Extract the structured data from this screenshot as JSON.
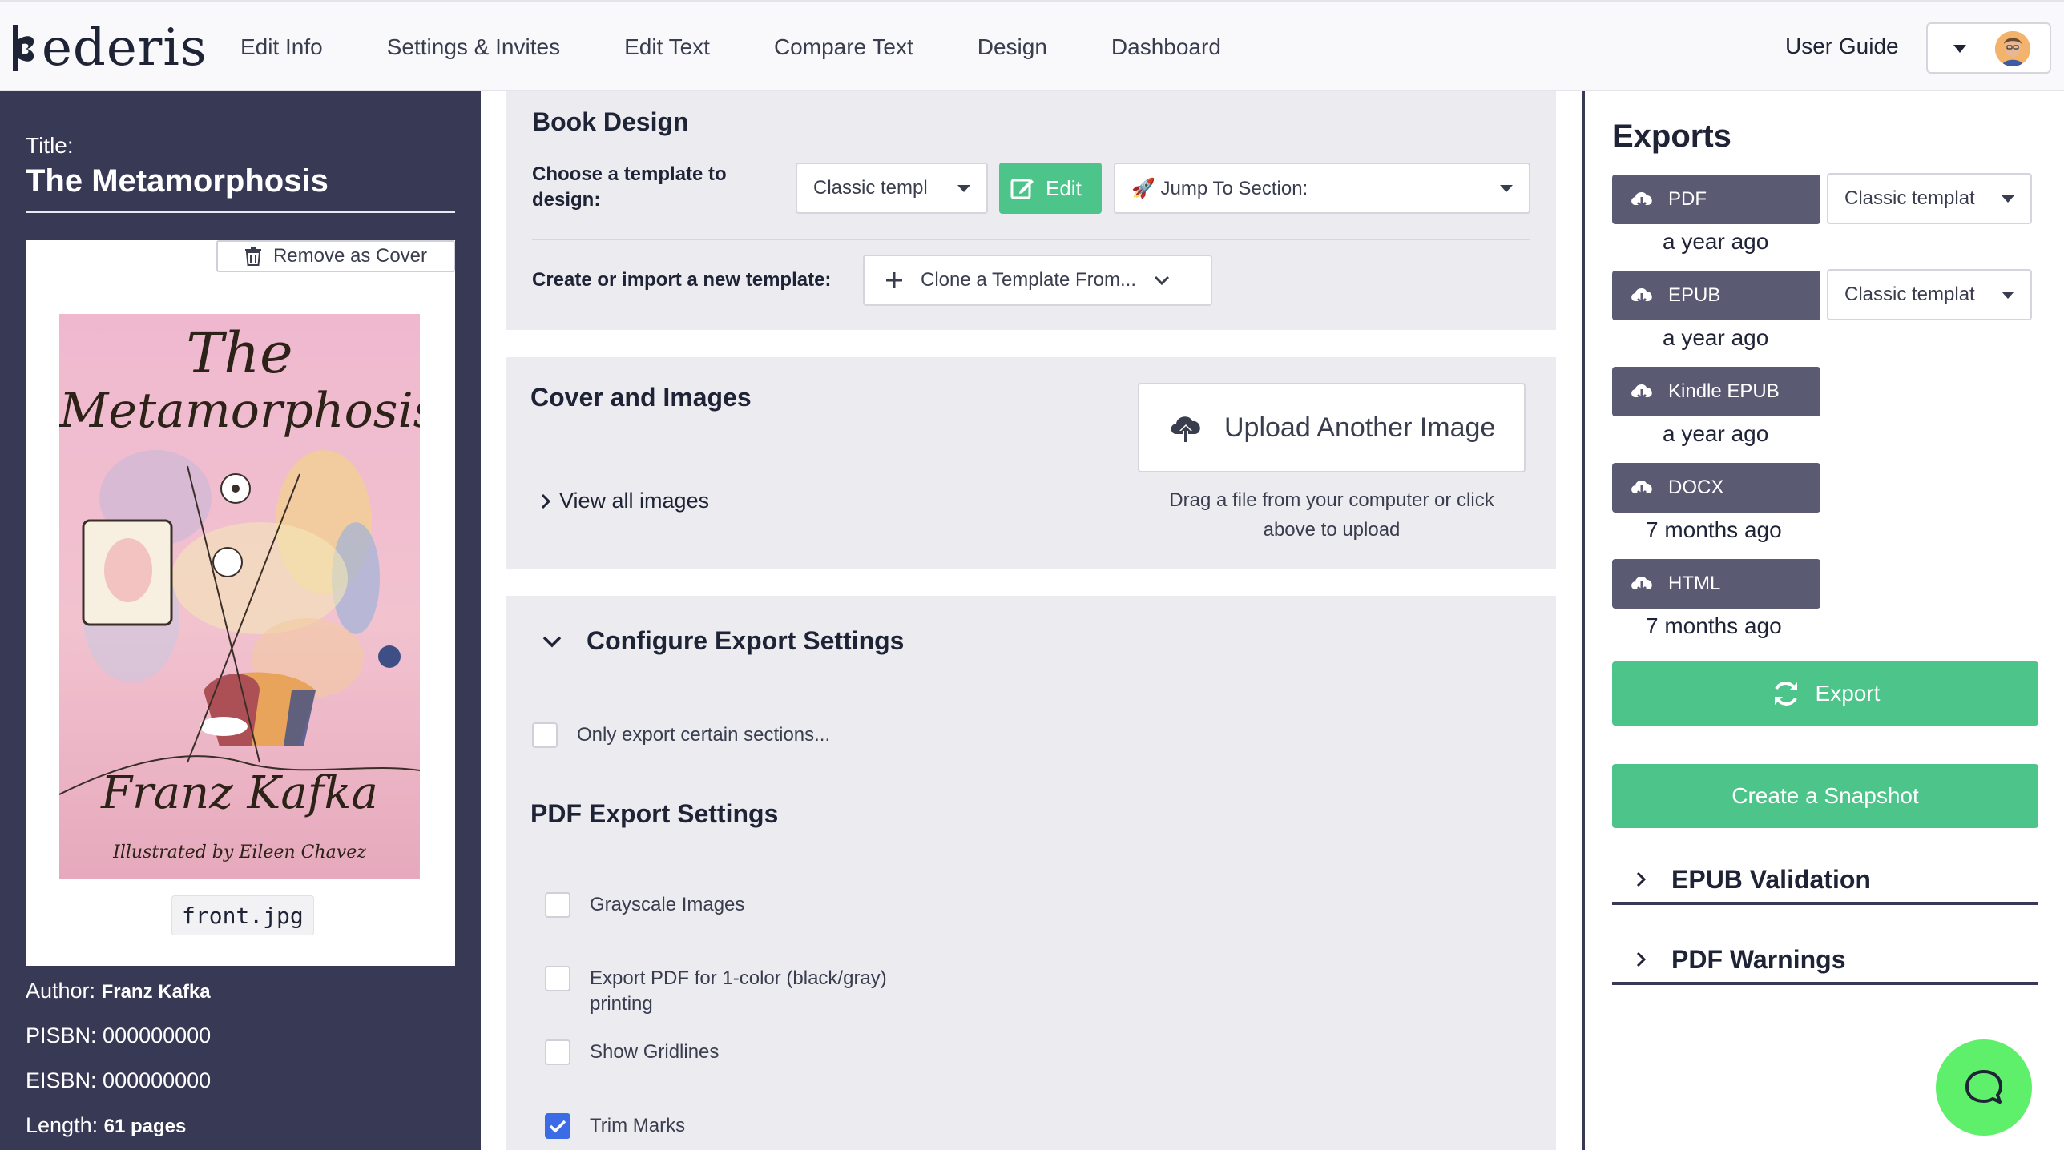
{
  "brand": {
    "name": "ederis"
  },
  "nav": {
    "items": [
      "Edit Info",
      "Settings & Invites",
      "Edit Text",
      "Compare Text",
      "Design",
      "Dashboard"
    ],
    "user_guide": "User Guide"
  },
  "sidebar": {
    "title_label": "Title:",
    "title": "The Metamorphosis",
    "remove_cover": "Remove as Cover",
    "cover": {
      "title_line1": "The",
      "title_line2": "Metamorphosis",
      "author": "Franz Kafka",
      "illustrator": "Illustrated by Eileen Chavez"
    },
    "filename": "front.jpg",
    "author_label": "Author:",
    "author": "Franz Kafka",
    "pisbn_label": "PISBN:",
    "pisbn": "000000000",
    "eisbn_label": "EISBN:",
    "eisbn": "000000000",
    "length_label": "Length:",
    "length": "61 pages"
  },
  "book_design": {
    "heading": "Book Design",
    "choose_label": "Choose a template to design:",
    "template_value": "Classic templ",
    "edit_label": "Edit",
    "jump_label": "🚀 Jump To Section:",
    "create_label": "Create or import a new template:",
    "clone_label": "Clone a Template From..."
  },
  "cover_images": {
    "heading": "Cover and Images",
    "view_all": "View all images",
    "upload_label": "Upload Another Image",
    "upload_hint": "Drag a file from your computer or click above to upload"
  },
  "export_settings": {
    "heading": "Configure Export Settings",
    "only_sections": "Only export certain sections...",
    "pdf_heading": "PDF Export Settings",
    "options": [
      {
        "label": "Grayscale Images",
        "checked": false
      },
      {
        "label": "Export PDF for 1-color (black/gray) printing",
        "checked": false
      },
      {
        "label": "Show Gridlines",
        "checked": false
      },
      {
        "label": "Trim Marks",
        "checked": true
      }
    ]
  },
  "exports": {
    "heading": "Exports",
    "items": [
      {
        "label": "PDF",
        "time": "a year ago",
        "template": "Classic templat"
      },
      {
        "label": "EPUB",
        "time": "a year ago",
        "template": "Classic templat"
      },
      {
        "label": "Kindle EPUB",
        "time": "a year ago"
      },
      {
        "label": "DOCX",
        "time": "7 months ago"
      },
      {
        "label": "HTML",
        "time": "7 months ago"
      }
    ],
    "export_button": "Export",
    "snapshot_button": "Create a Snapshot",
    "sections": [
      "EPUB Validation",
      "PDF Warnings"
    ]
  },
  "colors": {
    "sidebar_bg": "#373955",
    "accent_green": "#4cc48a",
    "export_button_bg": "#5a5b73",
    "panel_bg": "#ebebf0",
    "checkbox_checked": "#3b6ce6",
    "chat_green": "#5ef06a"
  },
  "icons": [
    "logo-mark-icon",
    "chevron-down-icon",
    "avatar",
    "trash-icon",
    "edit-icon",
    "plus-icon",
    "cloud-upload-icon",
    "chevron-right-icon",
    "check-icon",
    "refresh-icon",
    "chat-icon"
  ]
}
